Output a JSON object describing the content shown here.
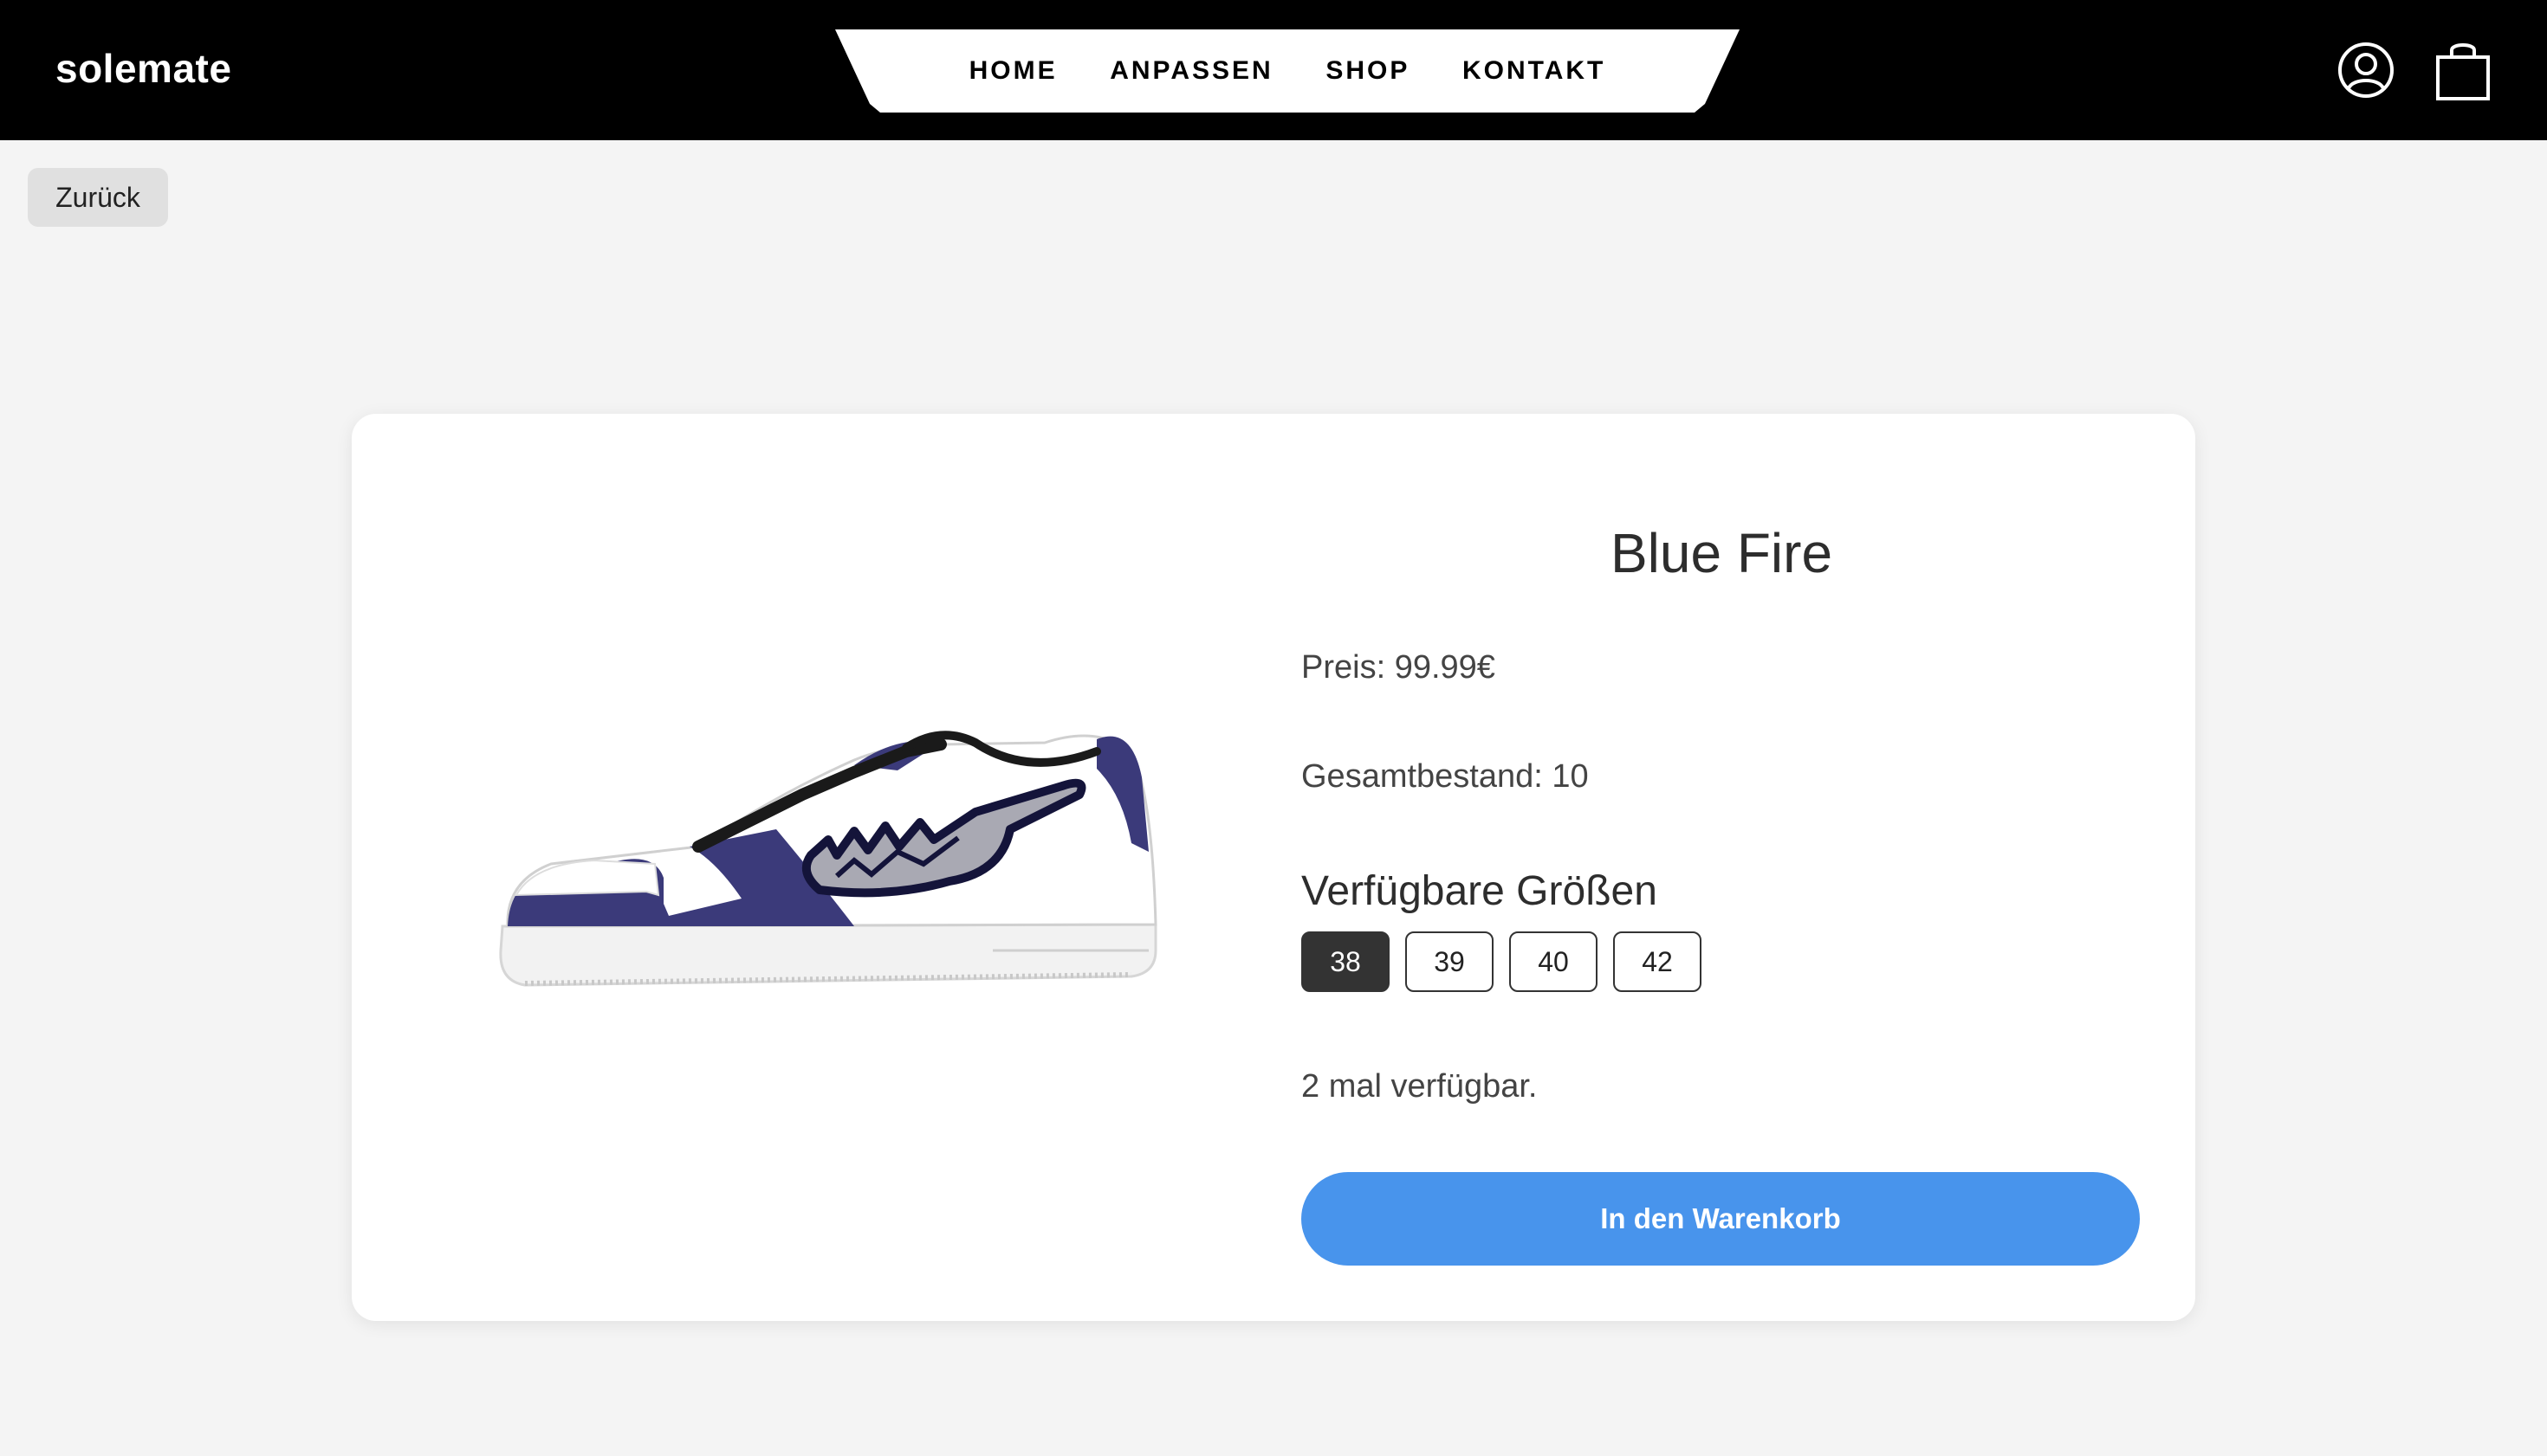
{
  "header": {
    "logo": "solemate",
    "nav": [
      {
        "label": "HOME"
      },
      {
        "label": "ANPASSEN"
      },
      {
        "label": "SHOP"
      },
      {
        "label": "KONTAKT"
      }
    ],
    "icons": {
      "account": "account-circle-icon",
      "cart": "shopping-bag-icon"
    }
  },
  "back_label": "Zurück",
  "product": {
    "name": "Blue Fire",
    "price_text": "Preis: 99.99€",
    "stock_text": "Gesamtbestand: 10",
    "sizes_heading": "Verfügbare Größen",
    "sizes": [
      {
        "label": "38",
        "selected": true
      },
      {
        "label": "39",
        "selected": false
      },
      {
        "label": "40",
        "selected": false
      },
      {
        "label": "42",
        "selected": false
      }
    ],
    "availability_text": "2 mal verfügbar.",
    "add_to_cart_label": "In den Warenkorb",
    "image": "blue-white-sneaker-with-flame-patch"
  },
  "colors": {
    "header_bg": "#000000",
    "page_bg": "#f4f4f4",
    "accent": "#4894ec",
    "selected_size_bg": "#333333",
    "shoe_navy": "#3b3a7a"
  }
}
